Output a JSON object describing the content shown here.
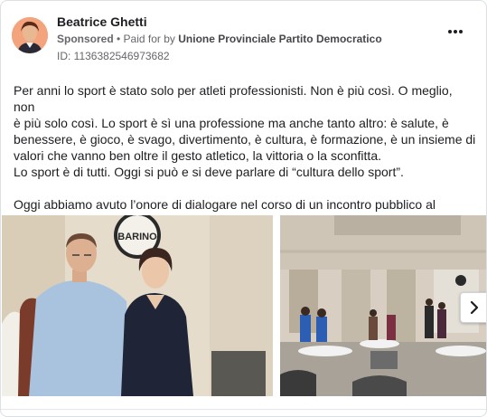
{
  "advertiser": {
    "name": "Beatrice Ghetti",
    "sponsored_label": "Sponsored",
    "separator": " • ",
    "paid_for_label": "Paid for by ",
    "payer": "Unione Provinciale Partito Democratico",
    "ad_id": "ID: 1136382546973682"
  },
  "more_icon": "more-horizontal-icon",
  "post": {
    "lines": [
      "Per anni lo sport è stato solo per atleti professionisti. Non è più così. O meglio, non",
      "è più solo così. Lo sport è sì una professione ma anche tanto altro: è salute, è",
      "benessere, è gioco, è svago, divertimento, è cultura, è formazione, è un insieme di",
      "valori che vanno ben oltre il gesto atletico, la vittoria o la sconfitta.",
      "Lo sport è di tutti. Oggi si può e si deve parlare di “cultura dello sport”."
    ],
    "last_line": "Oggi abbiamo avuto l’onore di dialogare nel corso di un incontro pubblico al Barin…"
  },
  "photo1": {
    "sign_text": "BARINO"
  },
  "carousel": {
    "next_icon": "chevron-right-icon"
  },
  "colors": {
    "text": "#1c1e21",
    "secondary": "#65676b",
    "border": "#dcdfe3"
  }
}
